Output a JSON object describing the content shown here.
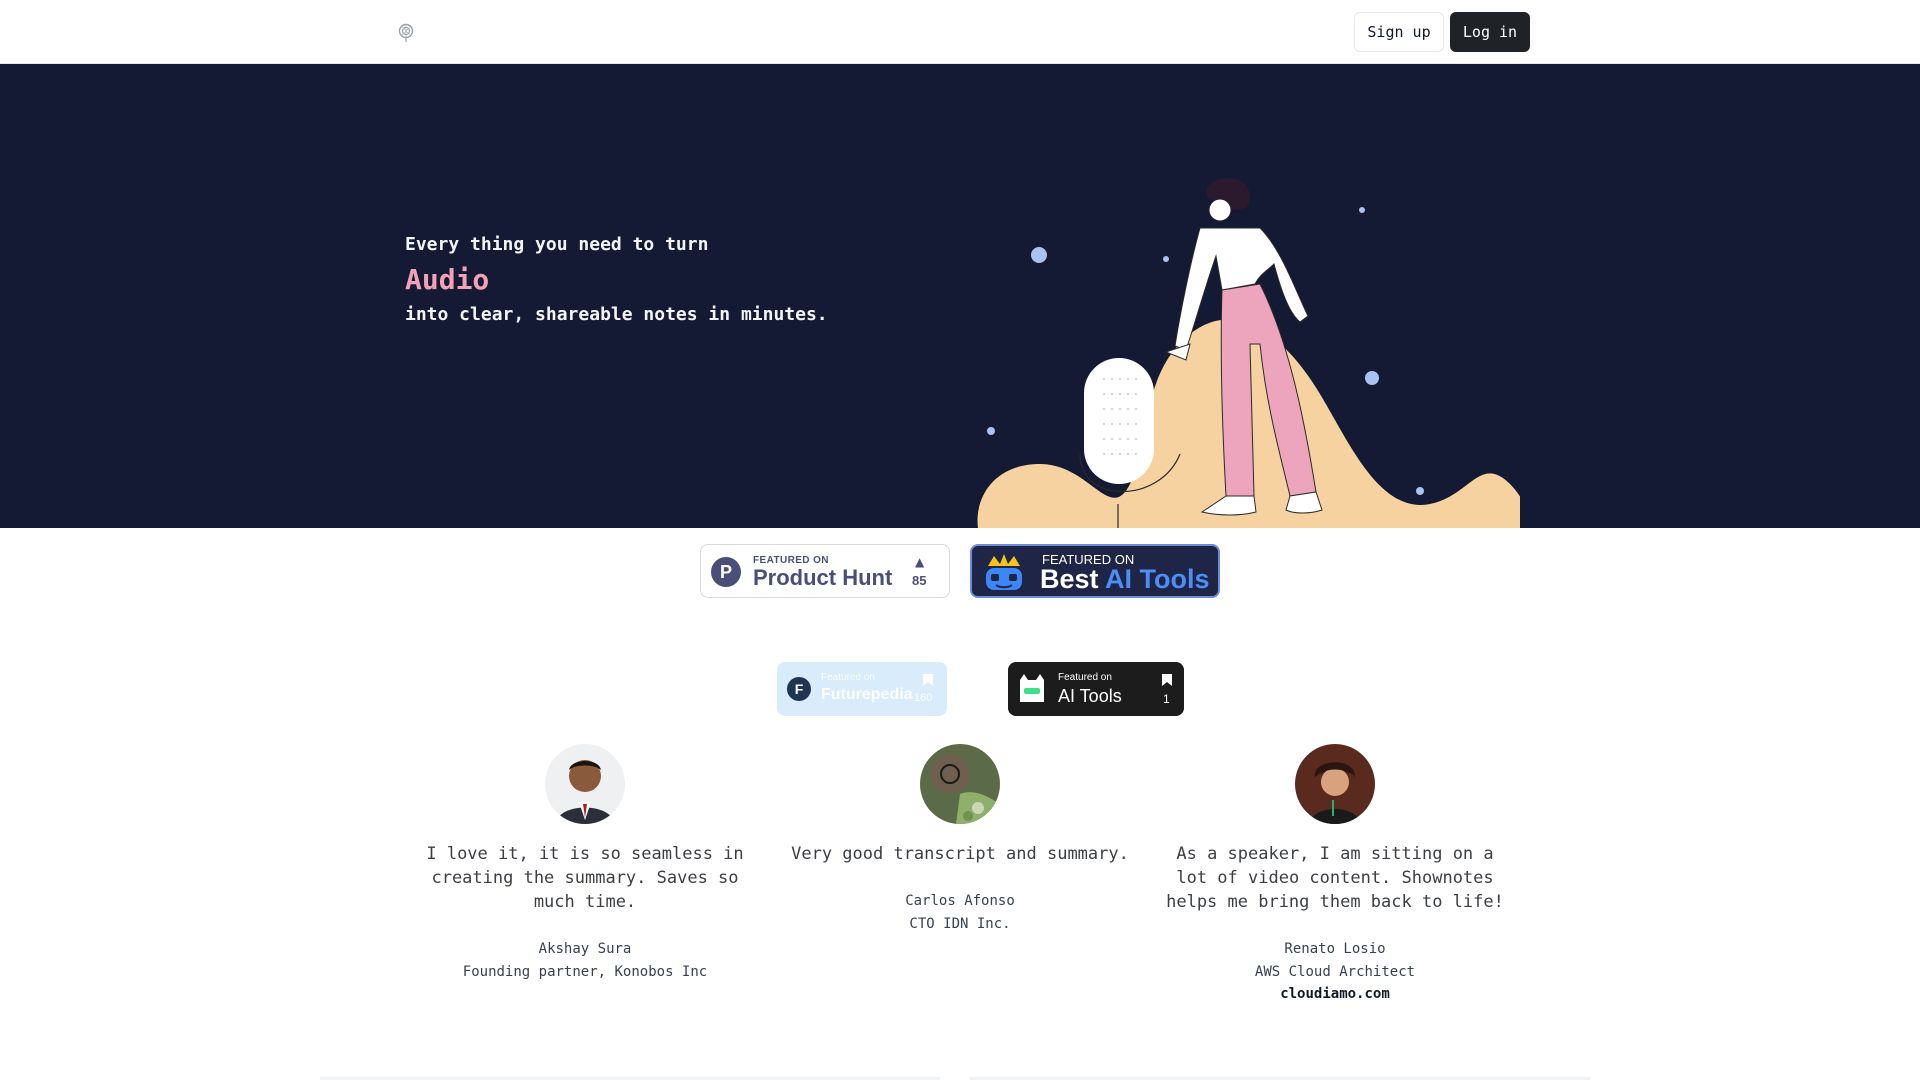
{
  "header": {
    "signup_label": "Sign up",
    "login_label": "Log in"
  },
  "hero": {
    "line1": "Every thing you need to turn",
    "highlight": "Audio",
    "line2": "into clear, shareable notes in minutes."
  },
  "badges": {
    "product_hunt": {
      "small": "FEATURED ON",
      "big": "Product Hunt",
      "count": "85"
    },
    "best_ai_tools": {
      "small": "FEATURED ON",
      "big_a": "Best ",
      "big_b": "AI Tools"
    },
    "futurepedia": {
      "small": "Featured on",
      "big": "Futurepedia",
      "count": "160"
    },
    "ai_tools": {
      "small": "Featured on",
      "big": "AI Tools",
      "count": "1"
    }
  },
  "testimonials": [
    {
      "quote": "I love it, it is so seamless in creating the summary. Saves so much time.",
      "name": "Akshay Sura",
      "role": "Founding partner, Konobos Inc"
    },
    {
      "quote": "Very good transcript and summary.",
      "name": "Carlos Afonso",
      "role": "CTO IDN Inc."
    },
    {
      "quote": "As a speaker, I am sitting on a lot of video content. Shownotes helps me bring them back to life!",
      "name": "Renato Losio",
      "role": "AWS Cloud Architect",
      "link": "cloudiamo.com"
    }
  ],
  "colors": {
    "hero_bg": "#141a33",
    "accent_pink": "#f3a2b6",
    "login_bg": "#1f2328"
  }
}
